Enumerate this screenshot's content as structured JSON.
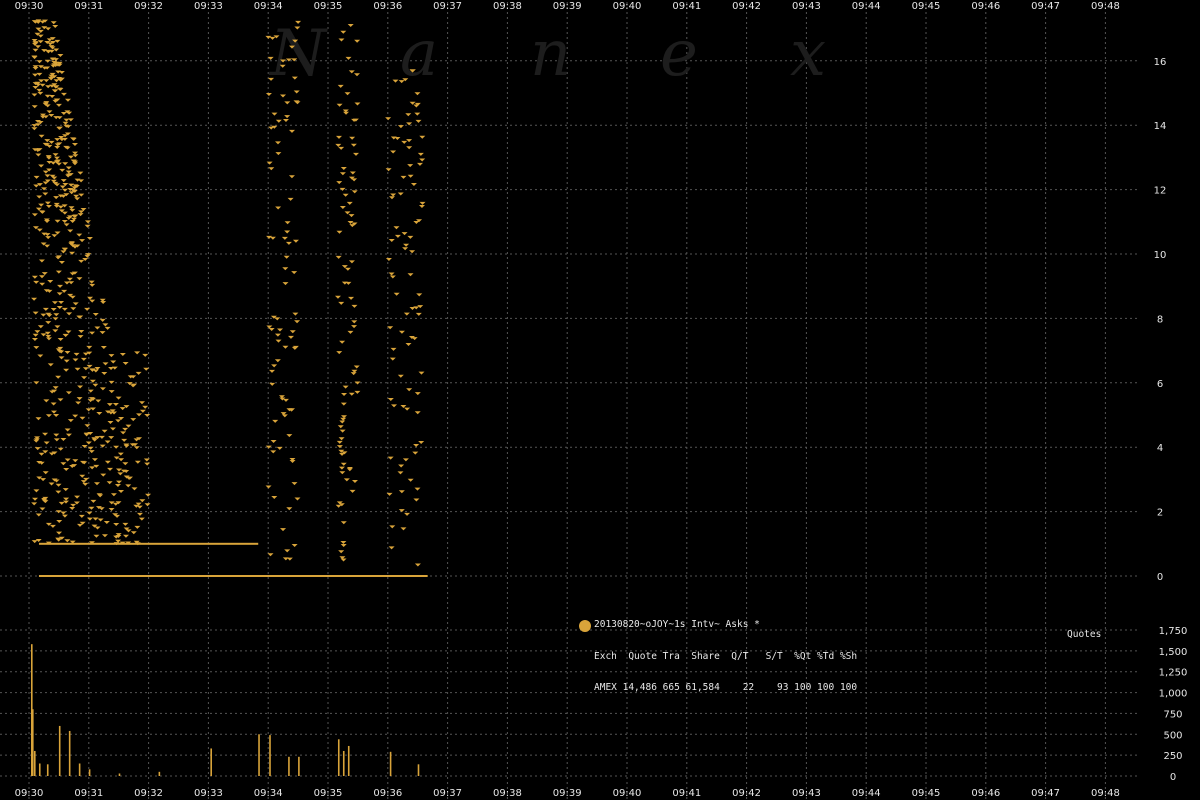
{
  "watermark": [
    "N",
    "a",
    "n",
    "e",
    "x"
  ],
  "legend": {
    "title": "20130820~oJOY~1s Intv~ Asks *",
    "header": "Exch  Quote Tra  Share  Q/T   S/T  %Qt %Td %Sh",
    "rows": [
      {
        "exch": "AMEX",
        "line": "AMEX 14,486 665 61,584    22    93 100 100 100",
        "color": "#d9a43a"
      }
    ]
  },
  "volume_label": "Quotes",
  "colors": {
    "series": "#d9a43a",
    "grid": "#555555",
    "axis_text": "#e6e6e6",
    "background": "#000000"
  },
  "chart_data": [
    {
      "type": "scatter",
      "title": "",
      "series": [
        {
          "name": "AMEX",
          "color": "#d9a43a"
        }
      ],
      "x_ticks": [
        "09:30",
        "09:31",
        "09:32",
        "09:33",
        "09:34",
        "09:35",
        "09:36",
        "09:37",
        "09:38",
        "09:39",
        "09:40",
        "09:41",
        "09:42",
        "09:43",
        "09:44",
        "09:45",
        "09:46",
        "09:47",
        "09:48"
      ],
      "y_ticks": [
        "0",
        "2",
        "4",
        "6",
        "8",
        "10",
        "12",
        "14",
        "16"
      ],
      "ylim": [
        0,
        17.4
      ],
      "grid": true,
      "clusters": [
        {
          "t_start": "09:30:00",
          "t_end": "09:31:00",
          "y_min": 1.0,
          "y_max": 17.3,
          "description": "dense descending ladder of ask quotes"
        },
        {
          "t_start": "09:31:00",
          "t_end": "09:32:00",
          "y_min": 1.0,
          "y_max": 7.0
        },
        {
          "t_start": "09:34:00",
          "t_end": "09:34:30",
          "y_min": 0.5,
          "y_max": 17.3
        },
        {
          "t_start": "09:35:10",
          "t_end": "09:35:30",
          "y_min": 0.3,
          "y_max": 17.3
        },
        {
          "t_start": "09:36:00",
          "t_end": "09:36:35",
          "y_min": 0.3,
          "y_max": 16.0
        }
      ]
    },
    {
      "type": "bar",
      "title": "",
      "ylabel": "Quotes",
      "y_ticks": [
        "0",
        "250",
        "500",
        "750",
        "1,000",
        "1,250",
        "1,500",
        "1,750"
      ],
      "ylim": [
        0,
        1750
      ],
      "x_ticks": [
        "09:30",
        "09:31",
        "09:32",
        "09:33",
        "09:34",
        "09:35",
        "09:36",
        "09:37",
        "09:38",
        "09:39",
        "09:40",
        "09:41",
        "09:42",
        "09:43",
        "09:44",
        "09:45",
        "09:46",
        "09:47",
        "09:48"
      ],
      "bars": [
        {
          "t": "09:30:02",
          "value": 1580
        },
        {
          "t": "09:30:03",
          "value": 800
        },
        {
          "t": "09:30:05",
          "value": 300
        },
        {
          "t": "09:30:10",
          "value": 150
        },
        {
          "t": "09:30:18",
          "value": 140
        },
        {
          "t": "09:30:30",
          "value": 600
        },
        {
          "t": "09:30:40",
          "value": 540
        },
        {
          "t": "09:30:50",
          "value": 150
        },
        {
          "t": "09:31:00",
          "value": 80
        },
        {
          "t": "09:31:30",
          "value": 30
        },
        {
          "t": "09:32:10",
          "value": 50
        },
        {
          "t": "09:33:02",
          "value": 330
        },
        {
          "t": "09:33:50",
          "value": 500
        },
        {
          "t": "09:34:01",
          "value": 490
        },
        {
          "t": "09:34:20",
          "value": 230
        },
        {
          "t": "09:34:30",
          "value": 230
        },
        {
          "t": "09:35:10",
          "value": 440
        },
        {
          "t": "09:35:15",
          "value": 300
        },
        {
          "t": "09:35:20",
          "value": 360
        },
        {
          "t": "09:36:02",
          "value": 290
        },
        {
          "t": "09:36:30",
          "value": 140
        }
      ]
    }
  ]
}
